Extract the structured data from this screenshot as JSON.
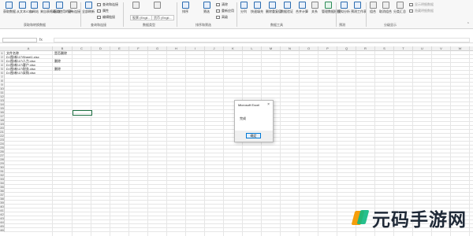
{
  "ribbon": {
    "buttons": [
      {
        "label": "获取数据",
        "icon": "database-icon"
      },
      {
        "label": "从文本/CSV",
        "icon": "text-file-icon"
      },
      {
        "label": "自网站",
        "icon": "web-icon"
      },
      {
        "label": "来自表格/区域",
        "icon": "table-icon"
      },
      {
        "label": "最近使用的源",
        "icon": "recent-sources-icon"
      },
      {
        "label": "现有连接",
        "icon": "connection-icon"
      },
      {
        "label": "全部刷新",
        "icon": "refresh-icon"
      },
      {
        "label": "股票",
        "icon": "stocks-icon"
      },
      {
        "label": "地理",
        "icon": "geography-icon"
      },
      {
        "label": "排序",
        "icon": "sort-icon"
      },
      {
        "label": "筛选",
        "icon": "filter-icon"
      },
      {
        "label": "分列",
        "icon": "text-to-columns-icon"
      },
      {
        "label": "快速填充",
        "icon": "flash-fill-icon"
      },
      {
        "label": "删除重复值",
        "icon": "remove-duplicates-icon"
      },
      {
        "label": "数据验证",
        "icon": "data-validation-icon"
      },
      {
        "label": "合并计算",
        "icon": "consolidate-icon"
      },
      {
        "label": "关系",
        "icon": "relationships-icon"
      },
      {
        "label": "管理数据模型",
        "icon": "data-model-icon"
      },
      {
        "label": "模拟分析",
        "icon": "what-if-icon"
      },
      {
        "label": "预测工作表",
        "icon": "forecast-icon"
      },
      {
        "label": "组合",
        "icon": "group-icon"
      },
      {
        "label": "取消组合",
        "icon": "ungroup-icon"
      },
      {
        "label": "分类汇总",
        "icon": "subtotal-icon"
      }
    ],
    "small_items": [
      {
        "label": "查询和连接",
        "icon": "queries-icon"
      },
      {
        "label": "属性",
        "icon": "properties-icon"
      },
      {
        "label": "编辑链接",
        "icon": "edit-links-icon"
      },
      {
        "label": "清除",
        "icon": "clear-icon"
      },
      {
        "label": "重新应用",
        "icon": "reapply-icon"
      },
      {
        "label": "高级",
        "icon": "advanced-icon"
      },
      {
        "label": "显示明细数据",
        "icon": "show-detail-icon"
      },
      {
        "label": "隐藏明细数据",
        "icon": "hide-detail-icon"
      }
    ],
    "dropdowns": [
      "股票 (Engli...",
      "货币 (Engli..."
    ],
    "groups": [
      "获取和转换数据",
      "查询和连接",
      "数据类型",
      "排序和筛选",
      "数据工具",
      "预测",
      "分级显示"
    ]
  },
  "formula_bar": {
    "name_box": "",
    "fx_label": "fx",
    "formula": ""
  },
  "sheet": {
    "columns": [
      "A",
      "B",
      "C",
      "D",
      "E",
      "F",
      "G",
      "H",
      "I",
      "J",
      "K",
      "L",
      "M",
      "N",
      "O",
      "P",
      "Q",
      "R",
      "S",
      "T",
      "U",
      "V",
      "W"
    ],
    "rows": [
      "1",
      "2",
      "3",
      "4",
      "5",
      "6",
      "7",
      "8",
      "9",
      "10",
      "11",
      "12",
      "13",
      "14",
      "15",
      "16",
      "17",
      "18",
      "19",
      "20",
      "21",
      "22",
      "23",
      "24",
      "25",
      "26",
      "27",
      "28",
      "29",
      "30",
      "31",
      "32",
      "33",
      "34",
      "35",
      "36",
      "37",
      "38",
      "39",
      "40",
      "41",
      "42",
      "43",
      "44",
      "45",
      "46"
    ],
    "cells": {
      "a1": "文件名称",
      "b1": "是否删除",
      "a2": "D:\\图\\新\\17\\Sheet1.xlsx",
      "a3": "D:\\图\\新\\17\\人力.xlsx",
      "b3": "删除",
      "a4": "D:\\图\\新\\17\\客户.xlsx",
      "a5": "D:\\图\\新\\17\\财务.xlsx",
      "b5": "删除",
      "a6": "D:\\图\\新\\17\\采购.xlsx"
    }
  },
  "dialog": {
    "title": "Microsoft Excel",
    "close": "×",
    "message": "完成",
    "ok_label": "确定"
  },
  "watermark": {
    "text": "元码手游网"
  }
}
